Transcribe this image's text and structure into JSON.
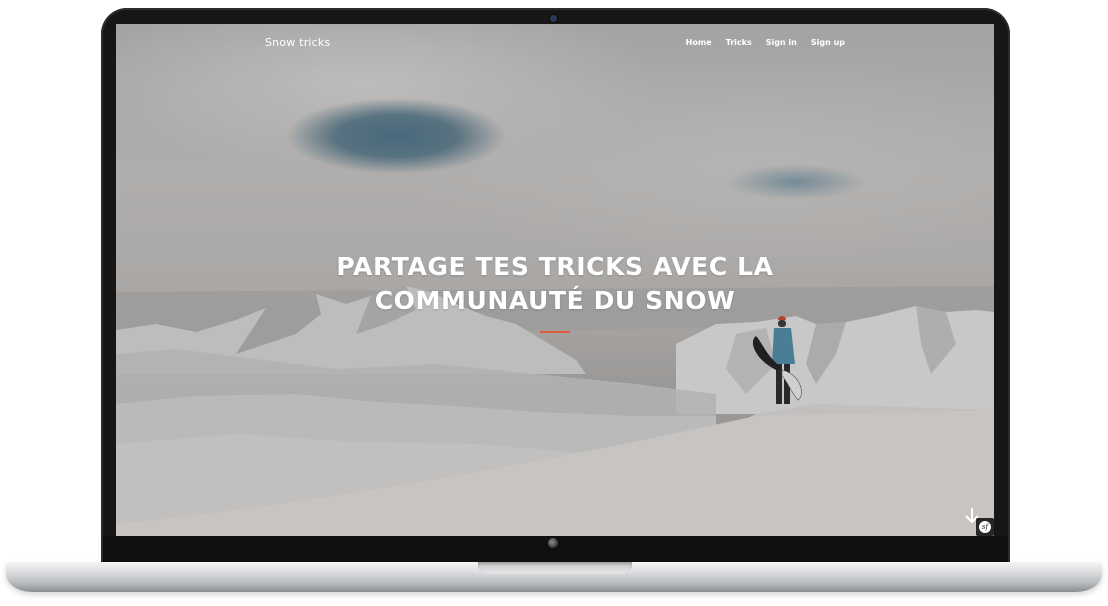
{
  "nav": {
    "brand": "Snow tricks",
    "links": [
      {
        "label": "Home"
      },
      {
        "label": "Tricks"
      },
      {
        "label": "Sign in"
      },
      {
        "label": "Sign up"
      }
    ]
  },
  "hero": {
    "title_line1": "PARTAGE TES TRICKS AVEC LA",
    "title_line2": "COMMUNAUTÉ DU SNOW",
    "accent_color": "#e05c3d",
    "background_image": "snowboarder standing on snowy mountain ridge under cloudy sky"
  },
  "scroll_down": {
    "icon": "arrow-down-icon"
  },
  "debug_toolbar": {
    "icon": "symfony-logo-icon",
    "letters": "sf"
  }
}
